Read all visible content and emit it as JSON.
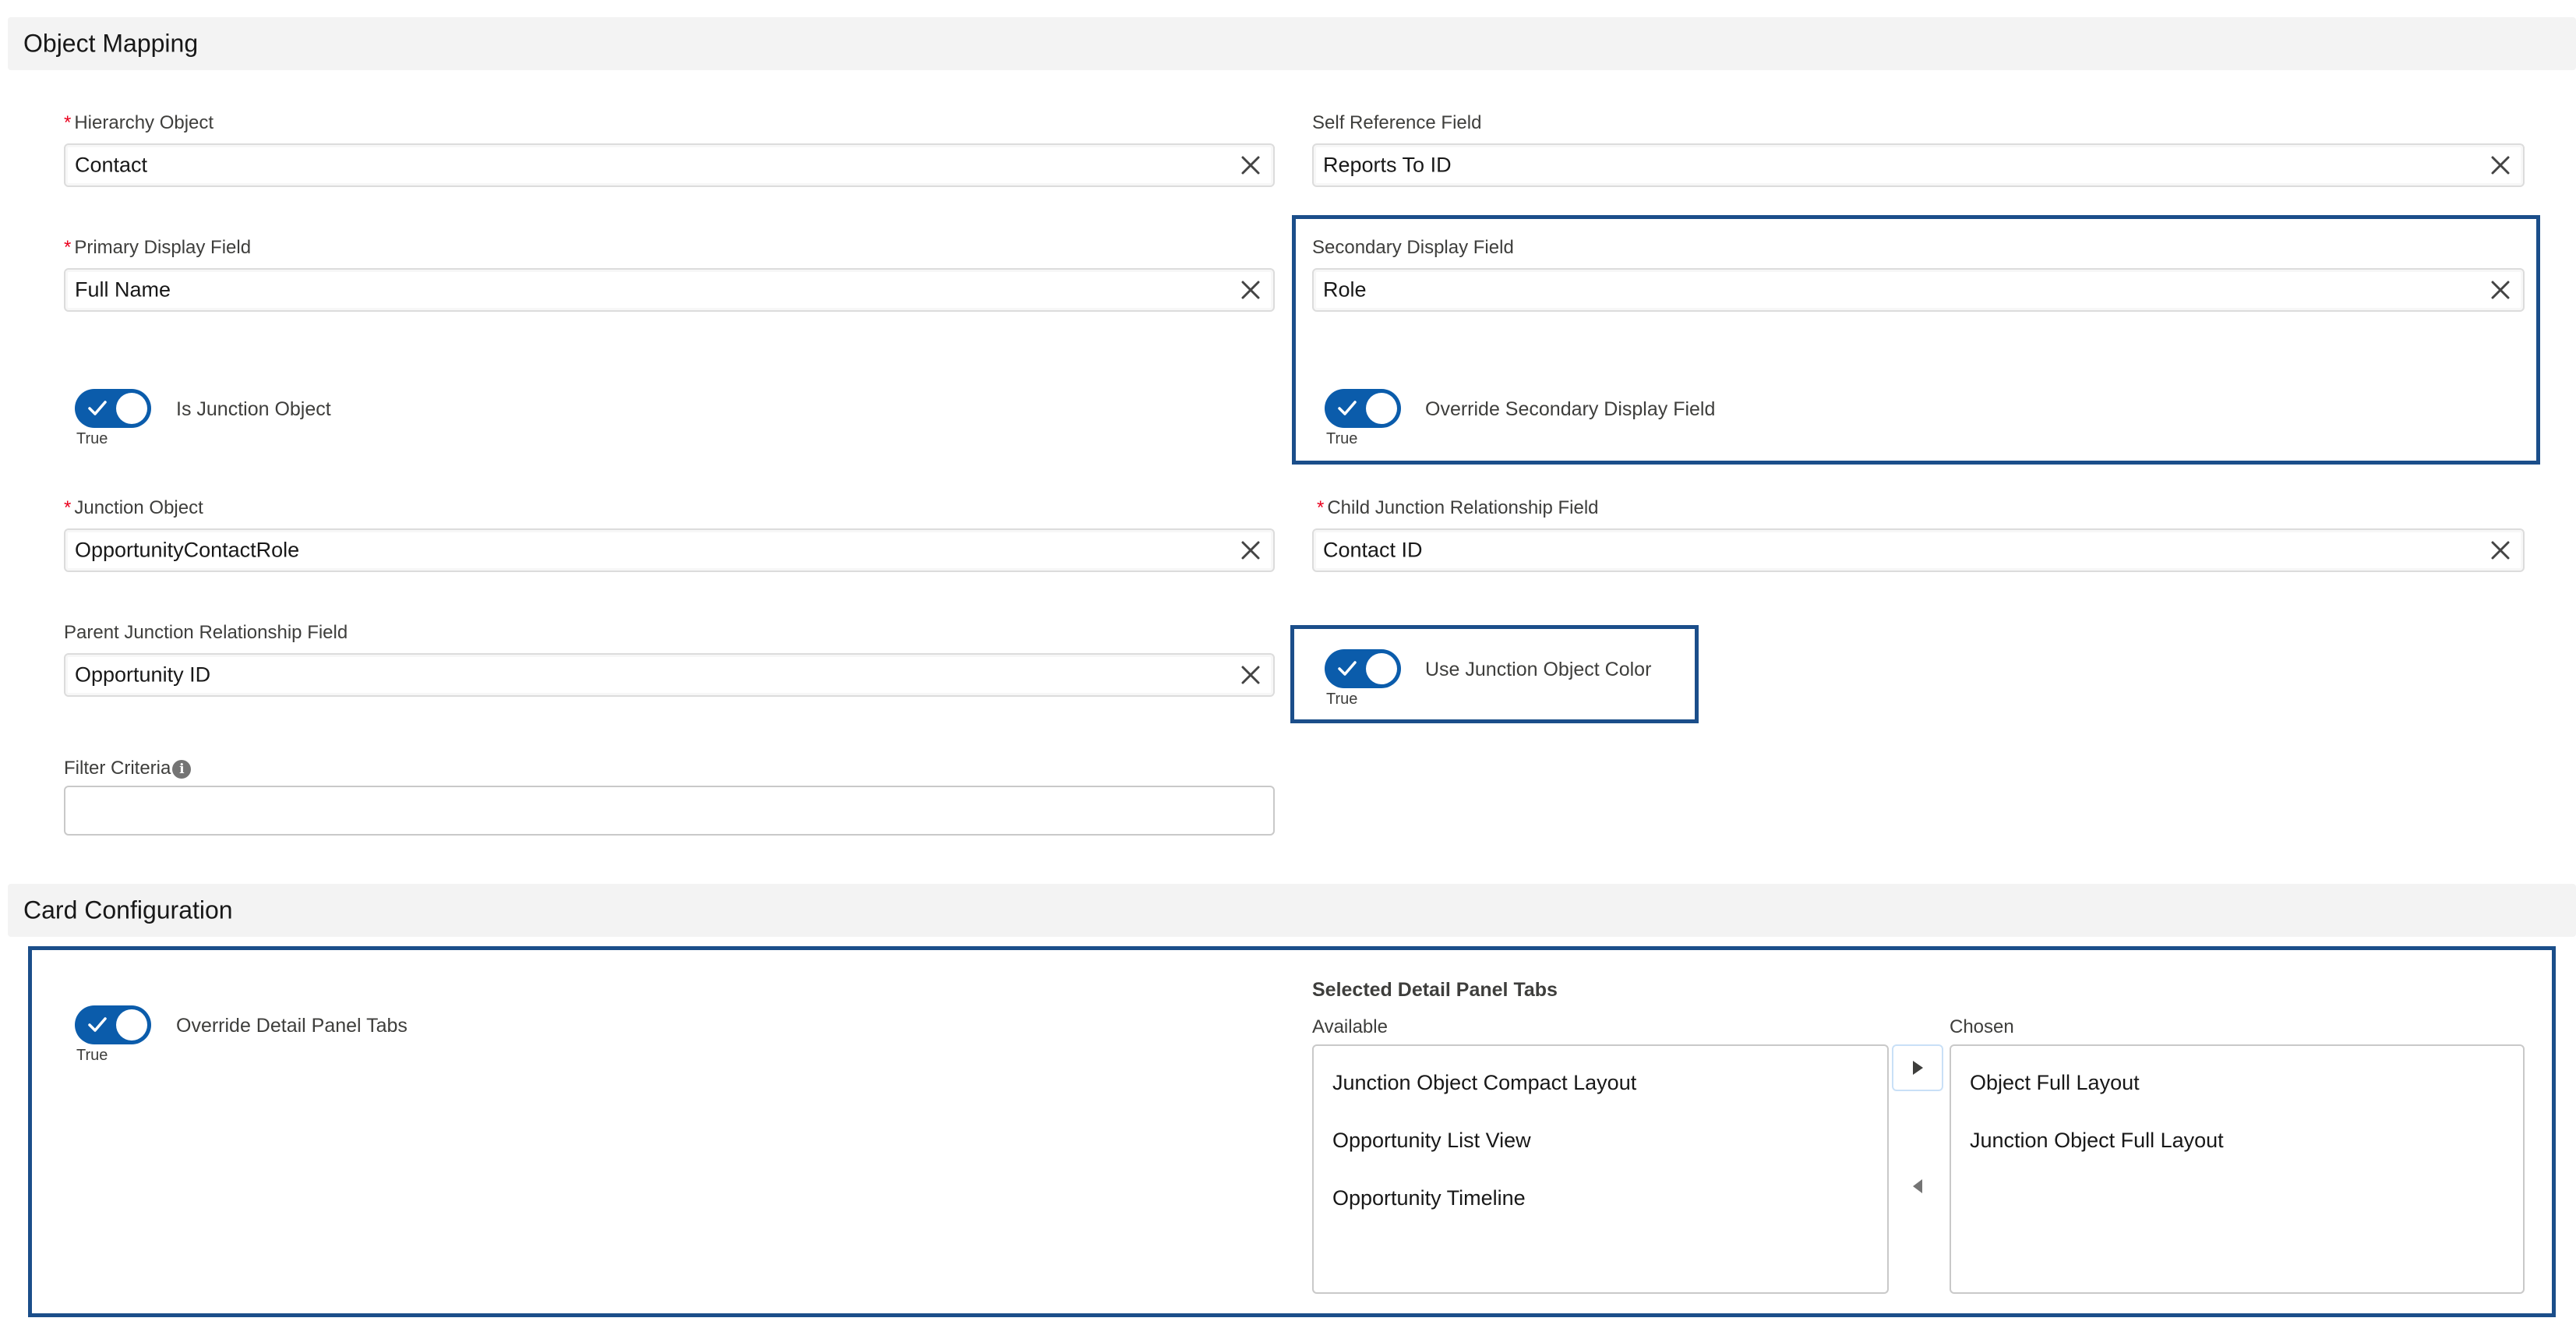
{
  "sections": {
    "object_mapping": "Object Mapping",
    "card_configuration": "Card Configuration"
  },
  "required_mark": "*",
  "fields": {
    "hierarchy_object": {
      "label": "Hierarchy Object",
      "value": "Contact"
    },
    "self_reference_field": {
      "label": "Self Reference Field",
      "value": "Reports To ID"
    },
    "primary_display_field": {
      "label": "Primary Display Field",
      "value": "Full Name"
    },
    "secondary_display_field": {
      "label": "Secondary Display Field",
      "value": "Role"
    },
    "junction_object": {
      "label": "Junction Object",
      "value": "OpportunityContactRole"
    },
    "child_junction_relationship_field": {
      "label": "Child Junction Relationship Field",
      "value": "Contact ID"
    },
    "parent_junction_relationship_field": {
      "label": "Parent Junction Relationship Field",
      "value": "Opportunity ID"
    },
    "filter_criteria": {
      "label": "Filter Criteria",
      "value": "",
      "info_icon": "info-icon"
    }
  },
  "toggles": {
    "is_junction_object": {
      "label": "Is Junction Object",
      "state": "True",
      "checked": true
    },
    "override_secondary_display_field": {
      "label": "Override Secondary Display Field",
      "state": "True",
      "checked": true
    },
    "use_junction_object_color": {
      "label": "Use Junction Object Color",
      "state": "True",
      "checked": true
    },
    "override_detail_panel_tabs": {
      "label": "Override Detail Panel Tabs",
      "state": "True",
      "checked": true
    }
  },
  "dual_listbox": {
    "title": "Selected Detail Panel Tabs",
    "available_label": "Available",
    "chosen_label": "Chosen",
    "available": [
      "Junction Object Compact Layout",
      "Opportunity List View",
      "Opportunity Timeline"
    ],
    "chosen": [
      "Object Full Layout",
      "Junction Object Full Layout"
    ]
  },
  "colors": {
    "toggle_on": "#0b5cab",
    "highlight_border": "#1b4e8a",
    "required": "#ea001e",
    "section_bg": "#f3f3f3"
  },
  "icons": {
    "clear": "close-icon",
    "toggle_check": "check-icon",
    "move_right": "caret-right-icon",
    "move_left": "caret-left-icon"
  }
}
